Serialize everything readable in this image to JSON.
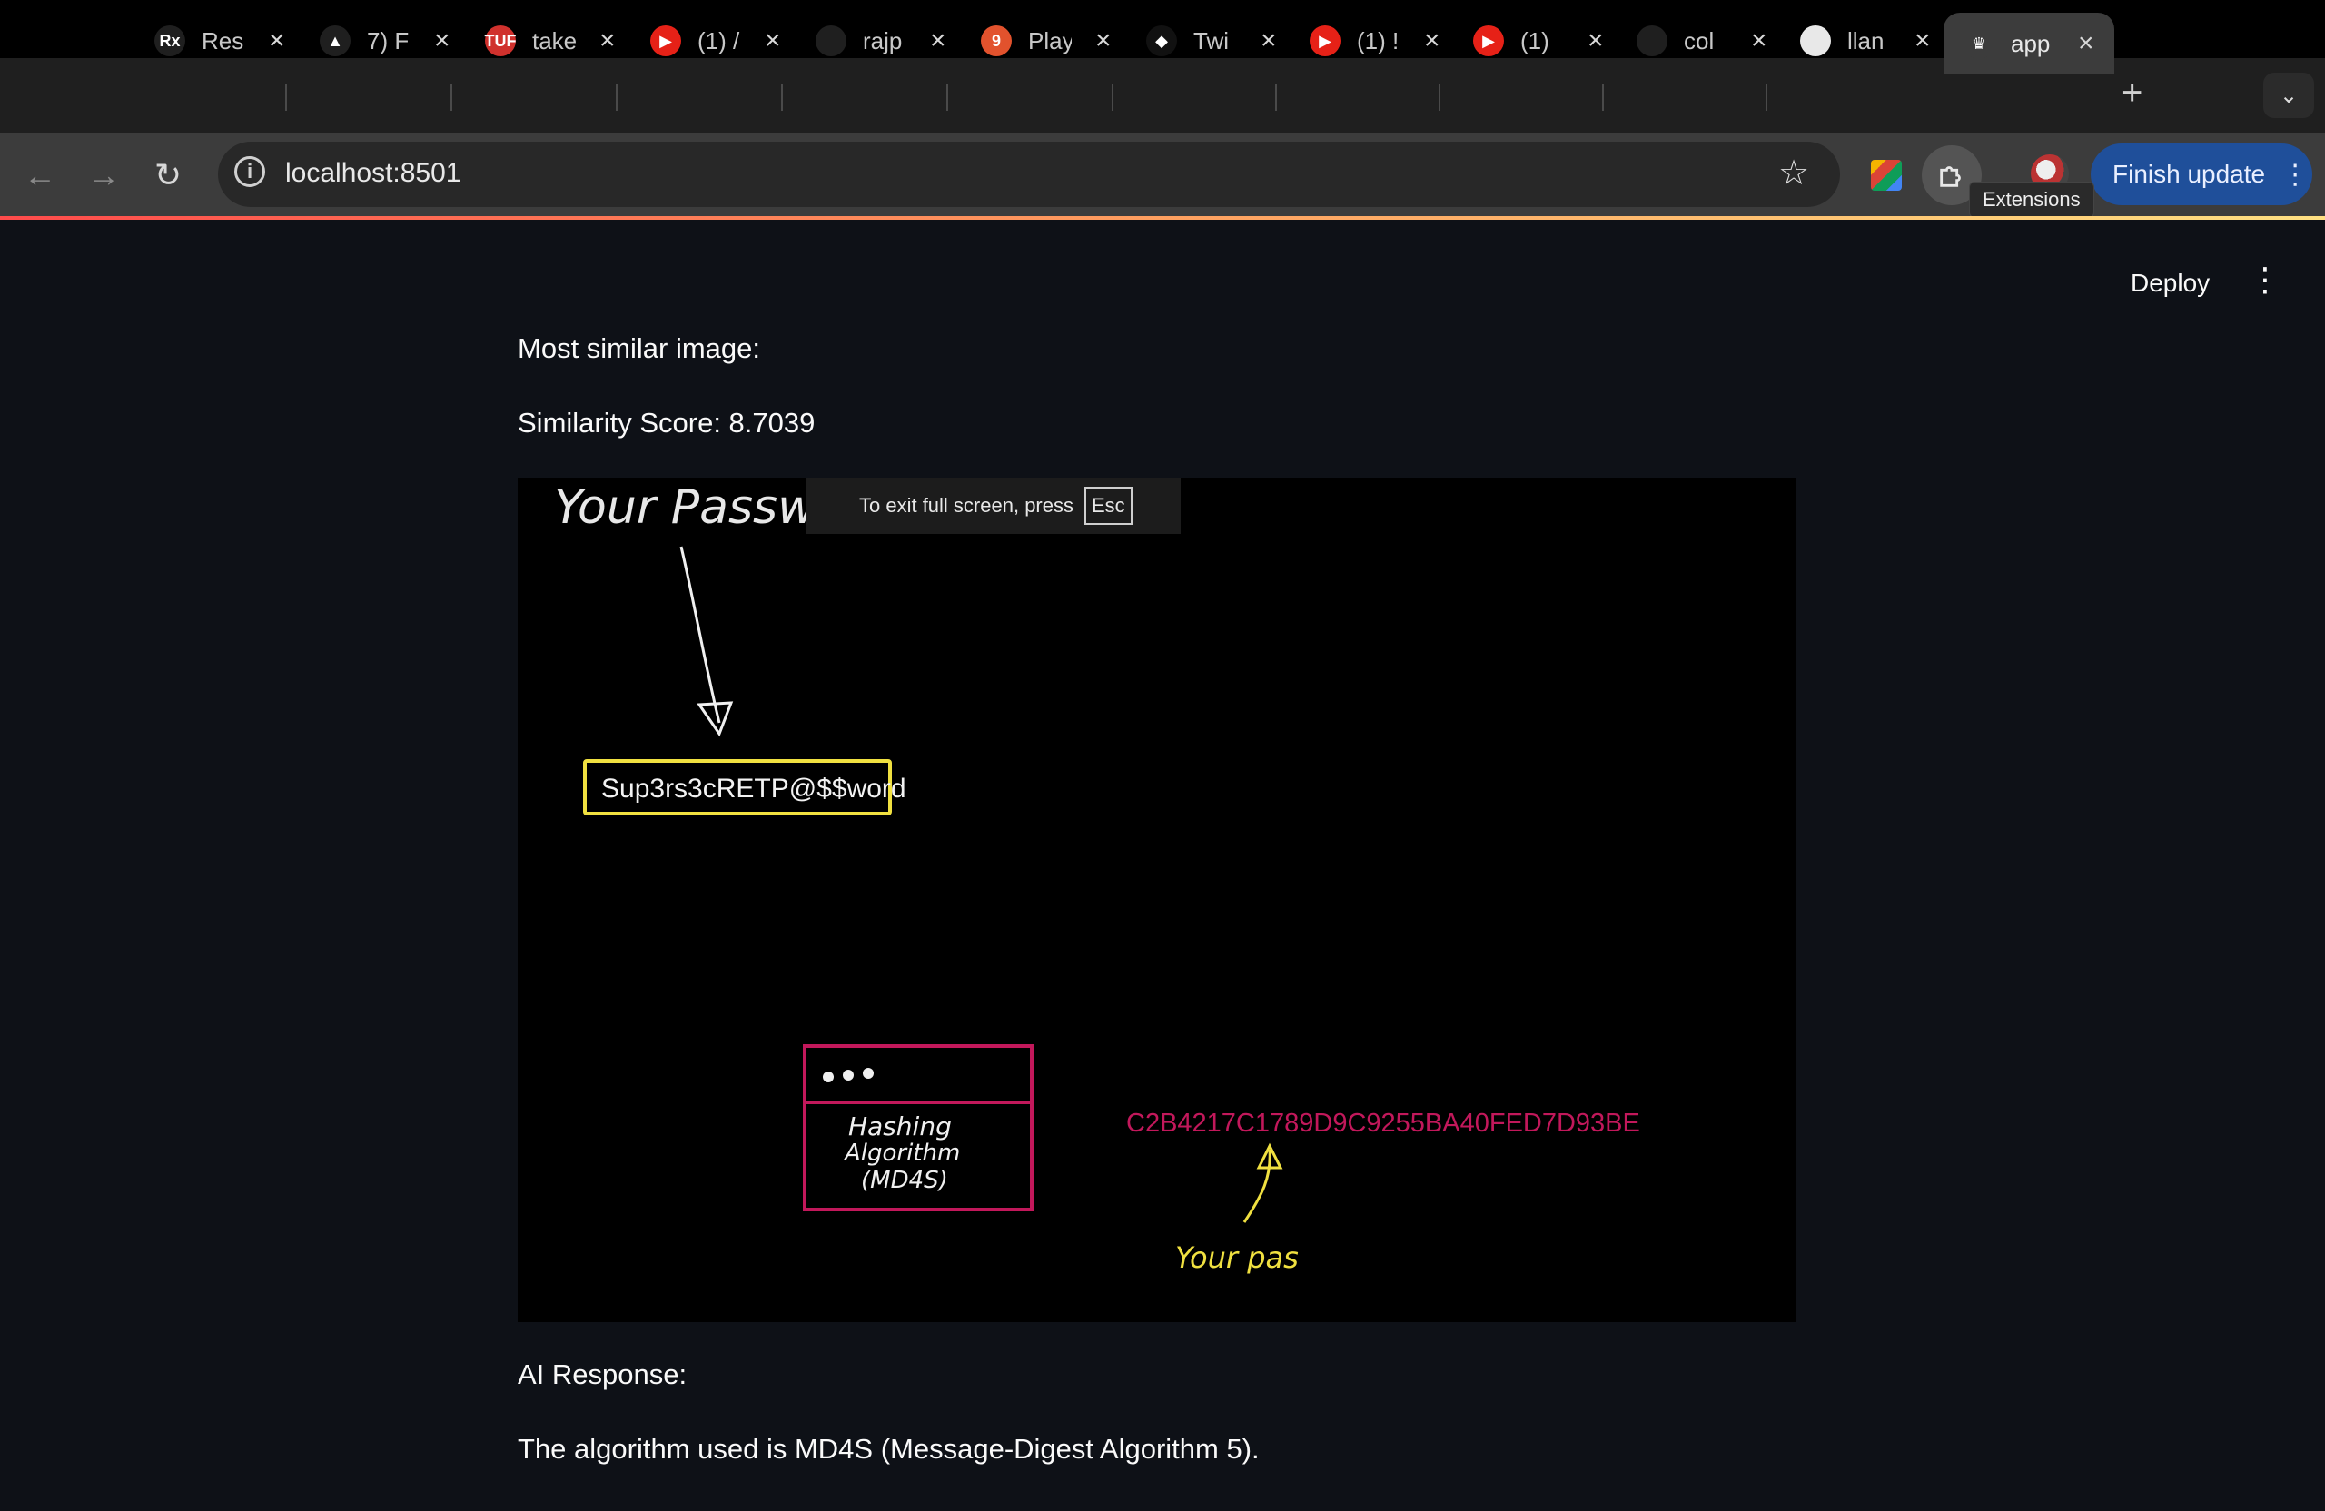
{
  "tabs": [
    {
      "title": "Res",
      "fav_text": "Rx",
      "fav_color": "#1f1f1f"
    },
    {
      "title": "7) F",
      "fav_text": "▲",
      "fav_color": "#1f1f1f"
    },
    {
      "title": "take",
      "fav_text": "TUF",
      "fav_color": "#d0312d"
    },
    {
      "title": "(1) /",
      "fav_text": "▶",
      "fav_color": "#e62117"
    },
    {
      "title": "rajp",
      "fav_text": "",
      "fav_color": "#1f1f1f"
    },
    {
      "title": "Play",
      "fav_text": "9",
      "fav_color": "#e2522d"
    },
    {
      "title": "Twi",
      "fav_text": "◆",
      "fav_color": "#111111"
    },
    {
      "title": "(1) !",
      "fav_text": "▶",
      "fav_color": "#e62117"
    },
    {
      "title": "(1)",
      "fav_text": "▶",
      "fav_color": "#e62117"
    },
    {
      "title": "col",
      "fav_text": "",
      "fav_color": "#1f1f1f"
    },
    {
      "title": "llan",
      "fav_text": "",
      "fav_color": "#e8e8e8"
    },
    {
      "title": "app",
      "fav_text": "♛",
      "fav_color": "#3c3c3c"
    }
  ],
  "toolbar": {
    "url": "localhost:8501",
    "finish_update": "Finish update",
    "extensions_tooltip": "Extensions"
  },
  "app": {
    "deploy_label": "Deploy",
    "most_similar_label": "Most similar image:",
    "similarity_label": "Similarity Score: 8.7039",
    "ai_response_label": "AI Response:",
    "ai_response_text": "The algorithm used is MD4S (Message-Digest Algorithm 5)."
  },
  "image": {
    "your_password": "Your Password",
    "password_value": "Sup3rs3cRETP@$$word",
    "hashing_line1": "Hashing",
    "hashing_line2": "Algorithm",
    "hashing_line3": "(MD4S)",
    "hash_output": "C2B4217C1789D9C9255BA40FED7D93BE",
    "your_pas": "Your pas"
  },
  "fullscreen_notice": {
    "text": "To exit full screen, press",
    "key": "Esc"
  },
  "colors": {
    "accent_blue": "#1f4f9a",
    "hash_magenta": "#c2185b",
    "box_yellow": "#f0e040"
  }
}
